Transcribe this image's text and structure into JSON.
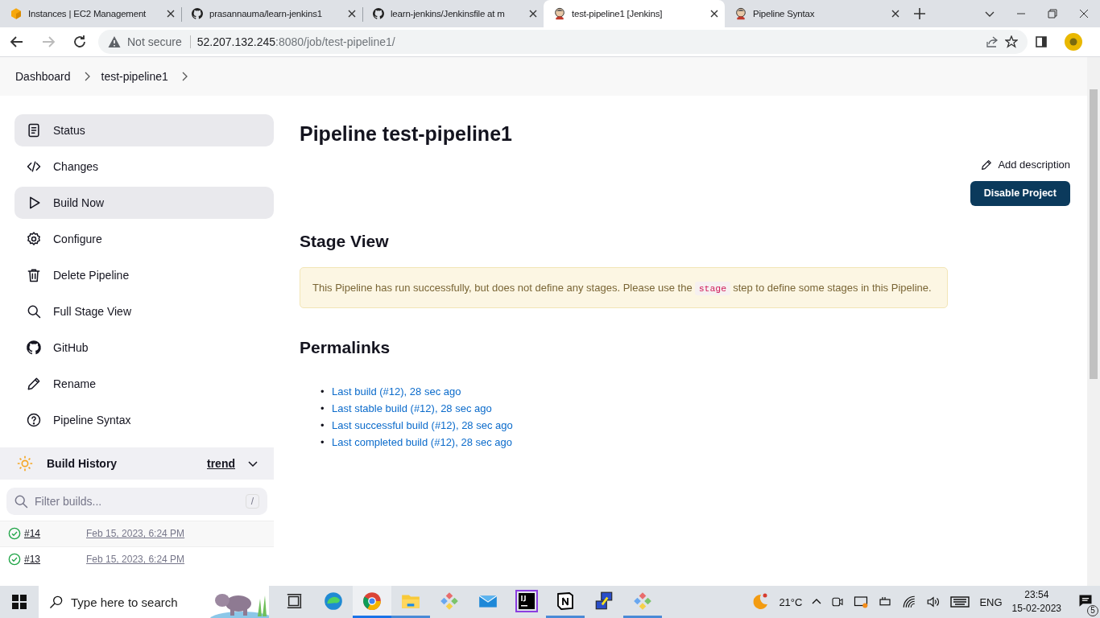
{
  "browser": {
    "tabs": [
      {
        "title": "Instances | EC2 Management",
        "kind": "aws",
        "selected": false
      },
      {
        "title": "prasannauma/learn-jenkins1",
        "kind": "github",
        "selected": false
      },
      {
        "title": "learn-jenkins/Jenkinsfile at m",
        "kind": "github",
        "selected": false
      },
      {
        "title": "test-pipeline1 [Jenkins]",
        "kind": "jenkins",
        "selected": true
      },
      {
        "title": "Pipeline Syntax",
        "kind": "jenkins",
        "selected": false
      }
    ],
    "security": "Not secure",
    "url_host": "52.207.132.245",
    "url_path": ":8080/job/test-pipeline1/"
  },
  "breadcrumbs": [
    "Dashboard",
    "test-pipeline1"
  ],
  "sidebar": {
    "items": [
      {
        "label": "Status",
        "kind": "status",
        "selected": true
      },
      {
        "label": "Changes",
        "kind": "code",
        "selected": false
      },
      {
        "label": "Build Now",
        "kind": "play",
        "selected": true
      },
      {
        "label": "Configure",
        "kind": "gear",
        "selected": false
      },
      {
        "label": "Delete Pipeline",
        "kind": "trash",
        "selected": false
      },
      {
        "label": "Full Stage View",
        "kind": "search",
        "selected": false
      },
      {
        "label": "GitHub",
        "kind": "github",
        "selected": false
      },
      {
        "label": "Rename",
        "kind": "pencil",
        "selected": false
      },
      {
        "label": "Pipeline Syntax",
        "kind": "help",
        "selected": false
      }
    ]
  },
  "build_history": {
    "title": "Build History",
    "trend": "trend",
    "filter": {
      "placeholder": "Filter builds...",
      "shortcut": "/"
    },
    "builds": [
      {
        "number": "#14",
        "date": "Feb 15, 2023, 6:24 PM",
        "kind": "success"
      },
      {
        "number": "#13",
        "date": "Feb 15, 2023, 6:24 PM",
        "kind": "success"
      }
    ]
  },
  "main": {
    "title": "Pipeline test-pipeline1",
    "add_description": "Add description",
    "disable_button": "Disable Project",
    "stage_view": {
      "heading": "Stage View",
      "notice_before": "This Pipeline has run successfully, but does not define any stages. Please use the",
      "notice_code": "stage",
      "notice_after": "step to define some stages in this Pipeline."
    },
    "permalinks": {
      "heading": "Permalinks",
      "links": [
        {
          "bullet": "•",
          "label": "Last build (#12), 28 sec ago"
        },
        {
          "bullet": "•",
          "label": "Last stable build (#12), 28 sec ago"
        },
        {
          "bullet": "•",
          "label": "Last successful build (#12), 28 sec ago"
        },
        {
          "bullet": "•",
          "label": "Last completed build (#12), 28 sec ago"
        }
      ]
    }
  },
  "taskbar": {
    "search_placeholder": "Type here to search",
    "apps": [
      {
        "kind": "taskview",
        "running": false,
        "active": false
      },
      {
        "kind": "edge",
        "running": false,
        "active": false
      },
      {
        "kind": "chrome",
        "running": true,
        "active": true
      },
      {
        "kind": "explorer",
        "running": true,
        "active": false
      },
      {
        "kind": "diamond",
        "running": false,
        "active": false
      },
      {
        "kind": "mail",
        "running": false,
        "active": false
      },
      {
        "kind": "intellij",
        "running": false,
        "active": false
      },
      {
        "kind": "notion",
        "running": true,
        "active": false
      },
      {
        "kind": "putty",
        "running": false,
        "active": false
      },
      {
        "kind": "diamond",
        "running": true,
        "active": false
      }
    ],
    "temperature": "21°C",
    "language": "ENG",
    "time": "23:54",
    "date": "15-02-2023",
    "notifications": "5"
  }
}
